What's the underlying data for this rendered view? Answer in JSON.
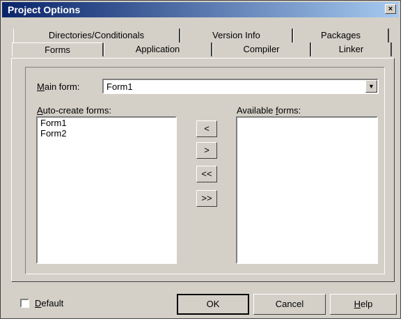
{
  "window": {
    "title": "Project Options",
    "close_label": "×"
  },
  "tabs": {
    "row1": [
      {
        "label": "Directories/Conditionals"
      },
      {
        "label": "Version Info"
      },
      {
        "label": "Packages"
      }
    ],
    "row2": [
      {
        "label": "Forms",
        "selected": true
      },
      {
        "label": "Application"
      },
      {
        "label": "Compiler"
      },
      {
        "label": "Linker"
      }
    ]
  },
  "main_form": {
    "label_mnemonic": "M",
    "label_rest": "ain form:",
    "value": "Form1"
  },
  "auto_create": {
    "label_mnemonic": "A",
    "label_rest": "uto-create forms:",
    "items": [
      "Form1",
      "Form2"
    ]
  },
  "available": {
    "label_prefix": "Available ",
    "label_mnemonic": "f",
    "label_rest": "orms:",
    "items": []
  },
  "move_buttons": {
    "move_left": "<",
    "move_right": ">",
    "move_all_left": "<<",
    "move_all_right": ">>"
  },
  "footer": {
    "default_mnemonic": "D",
    "default_rest": "efault",
    "default_checked": false,
    "ok_label": "OK",
    "cancel_label": "Cancel",
    "help_mnemonic": "H",
    "help_rest": "elp"
  }
}
